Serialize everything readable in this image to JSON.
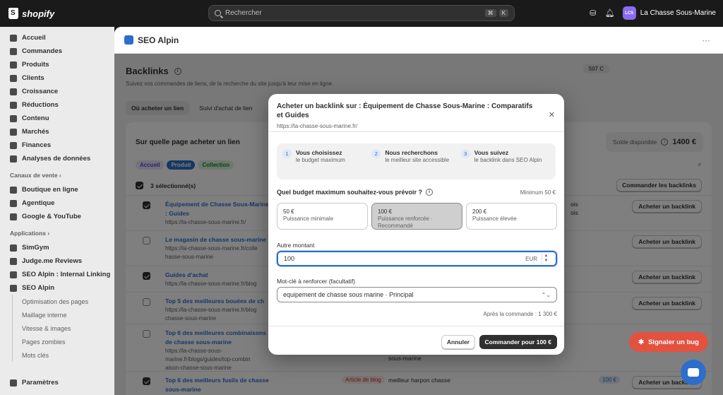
{
  "topbar": {
    "brand": "shopify",
    "search_placeholder": "Rechercher",
    "kbd": [
      "⌘",
      "K"
    ],
    "store_initials": "LCS",
    "store_name": "La Chasse Sous-Marine"
  },
  "sidebar": {
    "items": [
      "Accueil",
      "Commandes",
      "Produits",
      "Clients",
      "Croissance",
      "Réductions",
      "Contenu",
      "Marchés",
      "Finances",
      "Analyses de données"
    ],
    "sales_section": "Canaux de vente",
    "sales_items": [
      "Boutique en ligne",
      "Agentique",
      "Google & YouTube"
    ],
    "apps_section": "Applications",
    "app_items": [
      "SimGym",
      "Judge.me Reviews",
      "SEO Alpin : Internal Linking",
      "SEO Alpin"
    ],
    "sub_items": [
      "Optimisation des pages",
      "Maillage interne",
      "Vitesse & images",
      "Pages zombies",
      "Mots clés"
    ],
    "settings": "Paramètres"
  },
  "app": {
    "name": "SEO Alpin",
    "more": "···"
  },
  "page": {
    "title": "Backlinks",
    "subtitle": "Suivez vos commandes de liens, de la recherche du site jusqu'à leur mise en ligne.",
    "badge": "507 C",
    "tabs": [
      "Où acheter un lien",
      "Suivi d'achat de lien"
    ],
    "card_title": "Sur quelle page acheter un lien",
    "solde_label": "Solde disponible",
    "solde_value": "1400 €",
    "chips": [
      "Accueil",
      "Produit",
      "Collection"
    ],
    "selected": "3 sélectionné(s)",
    "order_btn": "Commander les backlinks",
    "rows": [
      {
        "title": "Équipement de Chasse Sous-Marine : Guides",
        "url": "https://la-chasse-sous-marine.fr/",
        "mid": "ois\nois",
        "btn": "Acheter un backlink",
        "checked": true
      },
      {
        "title": "Le magasin de chasse sous-marine",
        "url": "https://la-chasse-sous-marine.fr/colle\nhasse-sous-marine",
        "mid": "",
        "btn": "Acheter un backlink",
        "checked": false
      },
      {
        "title": "Guides d'achat",
        "url": "https://la-chasse-sous-marine.fr/blog",
        "mid": "",
        "btn": "Acheter un backlink",
        "checked": true
      },
      {
        "title": "Top 5 des meilleures bouées de ch",
        "url": "https://la-chasse-sous-marine.fr/blog\nchasse-sous-marine",
        "mid": "",
        "btn": "Acheter un backlink",
        "checked": false
      },
      {
        "title": "Top 6 des meilleures combinaisons de chasse sous-marine",
        "url": "https://la-chasse-sous-marine.fr/blogs/guides/top-combin\naison-chasse-sous-marine",
        "mid": "combinaisons de chasse\nsous-marine",
        "btn": "",
        "checked": false
      },
      {
        "title": "Top 6 des meilleurs fusils de chasse sous-marine",
        "url": "",
        "mid": "meilleur harpon chasse",
        "btn": "Acheter un backlink",
        "checked": true
      }
    ],
    "row6_tag": "Article de blog",
    "row6_badge": "100 €"
  },
  "modal": {
    "title": "Acheter un backlink sur : Équipement de Chasse Sous-Marine : Comparatifs et Guides",
    "url": "https://la-chasse-sous-marine.fr/",
    "steps": [
      {
        "n": "1",
        "title": "Vous choisissez",
        "desc": "le budget maximum"
      },
      {
        "n": "2",
        "title": "Nous recherchons",
        "desc": "le meilleur site accessible"
      },
      {
        "n": "3",
        "title": "Vous suivez",
        "desc": "le backlink dans SEO Alpin"
      }
    ],
    "question": "Quel budget maximum souhaitez-vous prévoir ?",
    "minimum": "Minimum 50 €",
    "options": [
      {
        "price": "50 €",
        "desc": "Puissance minimale"
      },
      {
        "price": "100 €",
        "desc": "Puissance renforcée · Recommandé"
      },
      {
        "price": "200 €",
        "desc": "Puissance élevée"
      }
    ],
    "selected_option": 1,
    "other_label": "Autre montant",
    "other_value": "100",
    "currency": "EUR",
    "keyword_label": "Mot-clé à renforcer (facultatif)",
    "keyword_value": "equipement de chasse sous marine · Principal",
    "after": "Après la commande : 1 300 €",
    "cancel": "Annuler",
    "submit": "Commander pour 100 €"
  },
  "bug_button": "Signaler un bug",
  "colors": {
    "accent": "#2c6ecb",
    "bug": "#e4513f",
    "dark": "#303030"
  }
}
